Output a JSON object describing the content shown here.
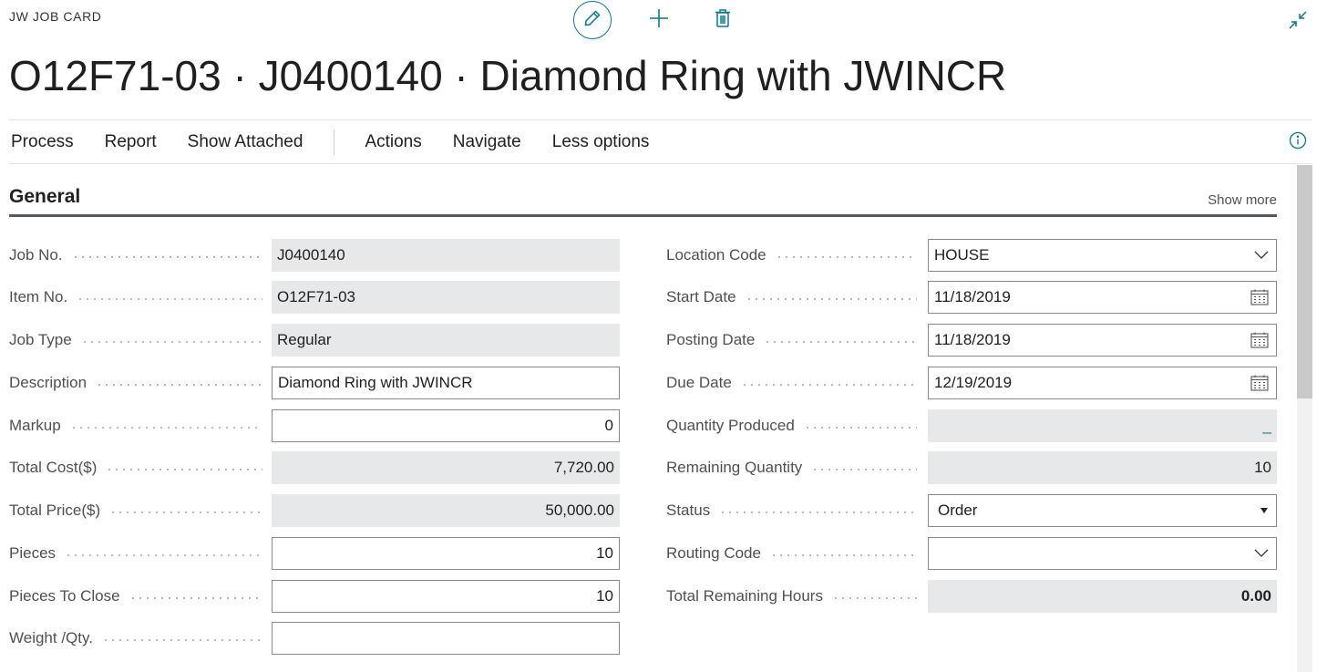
{
  "header": {
    "card_type": "JW JOB CARD",
    "title": "O12F71-03 · J0400140 · Diamond Ring with JWINCR",
    "accent_color": "#0a7a8a"
  },
  "toolbar": {
    "icons": [
      "edit-icon",
      "add-icon",
      "delete-icon",
      "collapse-icon"
    ]
  },
  "action_bar": {
    "items": [
      "Process",
      "Report",
      "Show Attached",
      "Actions",
      "Navigate",
      "Less options"
    ],
    "info_icon": "info-icon"
  },
  "section": {
    "title": "General",
    "show_more": "Show more"
  },
  "left_fields": [
    {
      "label": "Job No.",
      "value": "J0400140"
    },
    {
      "label": "Item No.",
      "value": "O12F71-03"
    },
    {
      "label": "Job Type",
      "value": "Regular"
    },
    {
      "label": "Description",
      "value": "Diamond Ring with JWINCR"
    },
    {
      "label": "Markup",
      "value": "0"
    },
    {
      "label": "Total Cost($)",
      "value": "7,720.00"
    },
    {
      "label": "Total Price($)",
      "value": "50,000.00"
    },
    {
      "label": "Pieces",
      "value": "10"
    },
    {
      "label": "Pieces To Close",
      "value": "10"
    },
    {
      "label": "Weight /Qty.",
      "value": ""
    }
  ],
  "right_fields": [
    {
      "label": "Location Code",
      "value": "HOUSE"
    },
    {
      "label": "Start Date",
      "value": "11/18/2019"
    },
    {
      "label": "Posting Date",
      "value": "11/18/2019"
    },
    {
      "label": "Due Date",
      "value": "12/19/2019"
    },
    {
      "label": "Quantity Produced",
      "value": "_"
    },
    {
      "label": "Remaining Quantity",
      "value": "10"
    },
    {
      "label": "Status",
      "value": "Order"
    },
    {
      "label": "Routing Code",
      "value": ""
    },
    {
      "label": "Total Remaining Hours",
      "value": "0.00"
    }
  ]
}
